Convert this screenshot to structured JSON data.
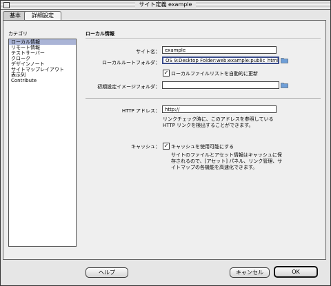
{
  "window": {
    "title": "サイト定義 example"
  },
  "tabs": [
    {
      "label": "基本"
    },
    {
      "label": "詳細設定"
    }
  ],
  "category": {
    "label": "カテゴリ",
    "items": [
      {
        "label": "ローカル情報"
      },
      {
        "label": "リモート情報"
      },
      {
        "label": "テストサーバー"
      },
      {
        "label": "クローク"
      },
      {
        "label": "デザインノート"
      },
      {
        "label": "サイトマップレイアウト"
      },
      {
        "label": "表示列"
      },
      {
        "label": "Contribute"
      }
    ]
  },
  "main": {
    "section_title": "ローカル情報",
    "site_name": {
      "label": "サイト名：",
      "value": "example"
    },
    "local_root": {
      "label": "ローカルルートフォルダ：",
      "value": "OS 9:Desktop Folder:web:example:public_html"
    },
    "auto_refresh": {
      "label": "ローカルファイルリストを自動的に更新",
      "checked": true
    },
    "default_images": {
      "label": "初期設定イメージフォルダ：",
      "value": ""
    },
    "http_address": {
      "label": "HTTP アドレス：",
      "value": "http://",
      "note": "リンクチェック時に、このアドレスを参照している HTTP リンクを検出することができます。"
    },
    "cache": {
      "label": "キャッシュ：",
      "checkbox_label": "キャッシュを使用可能にする",
      "checked": true,
      "note": "サイトのファイルとアセット情報はキャッシュに保存されるので、[アセット] パネル、リンク管理、サイトマップの各機能を高速化できます。"
    }
  },
  "buttons": {
    "help": "ヘルプ",
    "cancel": "キャンセル",
    "ok": "OK"
  },
  "icons": {
    "folder": "folder-icon",
    "check": "checkmark-icon"
  },
  "colors": {
    "selection": "#aab4d6",
    "focus_ring": "#3a4c8c"
  }
}
